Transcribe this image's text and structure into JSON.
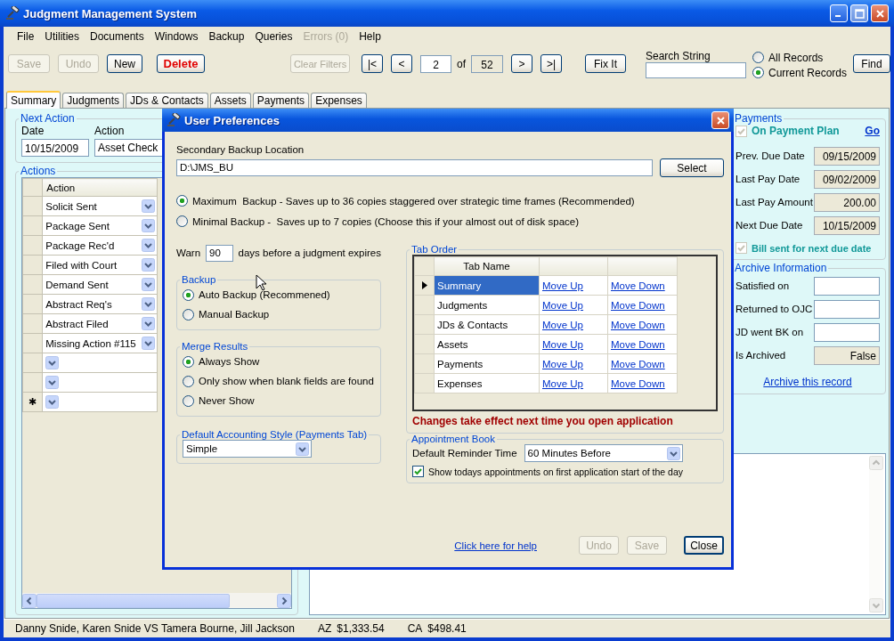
{
  "window": {
    "title": "Judgment Management System"
  },
  "menu": [
    {
      "label": "File",
      "disabled": false
    },
    {
      "label": "Utilities",
      "disabled": false
    },
    {
      "label": "Documents",
      "disabled": false
    },
    {
      "label": "Windows",
      "disabled": false
    },
    {
      "label": "Backup",
      "disabled": false
    },
    {
      "label": "Queries",
      "disabled": false
    },
    {
      "label": "Errors (0)",
      "disabled": true
    },
    {
      "label": "Help",
      "disabled": false
    }
  ],
  "toolbar": {
    "buttons": [
      {
        "label": "Save",
        "disabled": true,
        "kind": "normal"
      },
      {
        "label": "Undo",
        "disabled": true,
        "kind": "normal"
      },
      {
        "label": "New",
        "disabled": false,
        "kind": "normal"
      },
      {
        "label": "Delete",
        "disabled": false,
        "kind": "danger"
      }
    ],
    "clear_filters": {
      "label": "Clear Filters",
      "disabled": true
    },
    "navigator": {
      "first": "|<",
      "previous": "<",
      "record": "2",
      "of": "of",
      "total": "52",
      "next": ">",
      "last": ">|"
    },
    "fix_it": "Fix It",
    "search": {
      "label": "Search String"
    },
    "record_filter": [
      {
        "label": "All Records",
        "selected": false
      },
      {
        "label": "Current Records",
        "selected": true
      }
    ],
    "find": "Find"
  },
  "tabs": [
    {
      "label": "Summary",
      "selected": true
    },
    {
      "label": "Judgments",
      "selected": false
    },
    {
      "label": "JDs & Contacts",
      "selected": false
    },
    {
      "label": "Assets",
      "selected": false
    },
    {
      "label": "Payments",
      "selected": false
    },
    {
      "label": "Expenses",
      "selected": false
    }
  ],
  "summary": {
    "next_action": {
      "title": "Next Action",
      "date_label": "Date",
      "date": "10/15/2009",
      "action_label": "Action",
      "action": "Asset Check"
    },
    "actions": {
      "title": "Actions",
      "column": "Action",
      "rows": [
        {
          "kind": "entry",
          "action": "Solicit Sent"
        },
        {
          "kind": "entry",
          "action": "Package Sent"
        },
        {
          "kind": "entry",
          "action": "Package Rec'd"
        },
        {
          "kind": "entry",
          "action": "Filed with Court"
        },
        {
          "kind": "entry",
          "action": "Demand Sent"
        },
        {
          "kind": "entry",
          "action": "Abstract Req's"
        },
        {
          "kind": "entry",
          "action": "Abstract Filed"
        },
        {
          "kind": "entry",
          "action": "Missing Action #115"
        },
        {
          "kind": "blank"
        },
        {
          "kind": "blank"
        },
        {
          "kind": "new",
          "marker": "✱"
        }
      ]
    },
    "payments": {
      "title": "Payments",
      "on_payment_plan": {
        "label": "On Payment Plan",
        "checked": true,
        "disabled": true
      },
      "go": "Go",
      "fields": [
        {
          "label": "Prev. Due Date",
          "value": "09/15/2009",
          "editable": false
        },
        {
          "label": "Last Pay Date",
          "value": "09/02/2009",
          "editable": false
        },
        {
          "label": "Last Pay Amount",
          "value": "200.00",
          "editable": false
        },
        {
          "label": "Next Due Date",
          "value": "10/15/2009",
          "editable": false
        }
      ],
      "bill_sent": {
        "label": "Bill sent for next due date",
        "checked": true,
        "disabled": true
      }
    },
    "archive": {
      "title": "Archive Information",
      "fields": [
        {
          "label": "Satisfied on",
          "editable": true
        },
        {
          "label": "Returned to OJC",
          "editable": true
        },
        {
          "label": "JD went BK on",
          "editable": true
        },
        {
          "label": "Is Archived",
          "value": "False",
          "editable": false
        }
      ],
      "link": "Archive this record"
    }
  },
  "status_bar": {
    "case": "Danny Snide, Karen Snide VS Tamera Bourne, Jill Jackson",
    "balances": [
      {
        "state": "AZ",
        "amount": "$1,333.54"
      },
      {
        "state": "CA",
        "amount": "$498.41"
      }
    ]
  },
  "dialog": {
    "title": "User Preferences",
    "backup_location": {
      "label": "Secondary Backup Location",
      "value": "D:\\JMS_BU"
    },
    "select": "Select",
    "backup_modes": [
      {
        "label": "Maximum  Backup - Saves up to 36 copies staggered over strategic time frames (Recommended)",
        "selected": true
      },
      {
        "label": "Minimal Backup -  Saves up to 7 copies (Choose this if your almost out of disk space)",
        "selected": false
      }
    ],
    "warn": {
      "label": "Warn",
      "value": "90",
      "suffix": "days before a judgment expires"
    },
    "backup": {
      "title": "Backup",
      "options": [
        {
          "label": "Auto Backup (Recommened)",
          "selected": true
        },
        {
          "label": "Manual Backup",
          "selected": false
        }
      ]
    },
    "merge_results": {
      "title": "Merge Results",
      "options": [
        {
          "label": "Always Show",
          "selected": true
        },
        {
          "label": "Only show when blank fields are found",
          "selected": false
        },
        {
          "label": "Never Show",
          "selected": false
        }
      ]
    },
    "accounting": {
      "title": "Default Accounting Style (Payments Tab)",
      "value": "Simple"
    },
    "tab_order": {
      "title": "Tab Order",
      "column": "Tab Name",
      "rows": [
        {
          "name": "Summary",
          "selected": true,
          "move_up": "Move Up",
          "move_down": "Move Down"
        },
        {
          "name": "Judgments",
          "selected": false,
          "move_up": "Move Up",
          "move_down": "Move Down"
        },
        {
          "name": "JDs & Contacts",
          "selected": false,
          "move_up": "Move Up",
          "move_down": "Move Down"
        },
        {
          "name": "Assets",
          "selected": false,
          "move_up": "Move Up",
          "move_down": "Move Down"
        },
        {
          "name": "Payments",
          "selected": false,
          "move_up": "Move Up",
          "move_down": "Move Down"
        },
        {
          "name": "Expenses",
          "selected": false,
          "move_up": "Move Up",
          "move_down": "Move Down"
        }
      ],
      "note": "Changes take effect next time you open application"
    },
    "appointment_book": {
      "title": "Appointment Book",
      "reminder_label": "Default Reminder Time",
      "reminder": "60 Minutes Before",
      "show_today": {
        "label": "Show todays appointments on first application start of the day",
        "checked": true
      }
    },
    "help_link": "Click here for help",
    "buttons": [
      {
        "label": "Undo",
        "disabled": true
      },
      {
        "label": "Save",
        "disabled": true
      },
      {
        "label": "Close",
        "disabled": false
      }
    ]
  }
}
